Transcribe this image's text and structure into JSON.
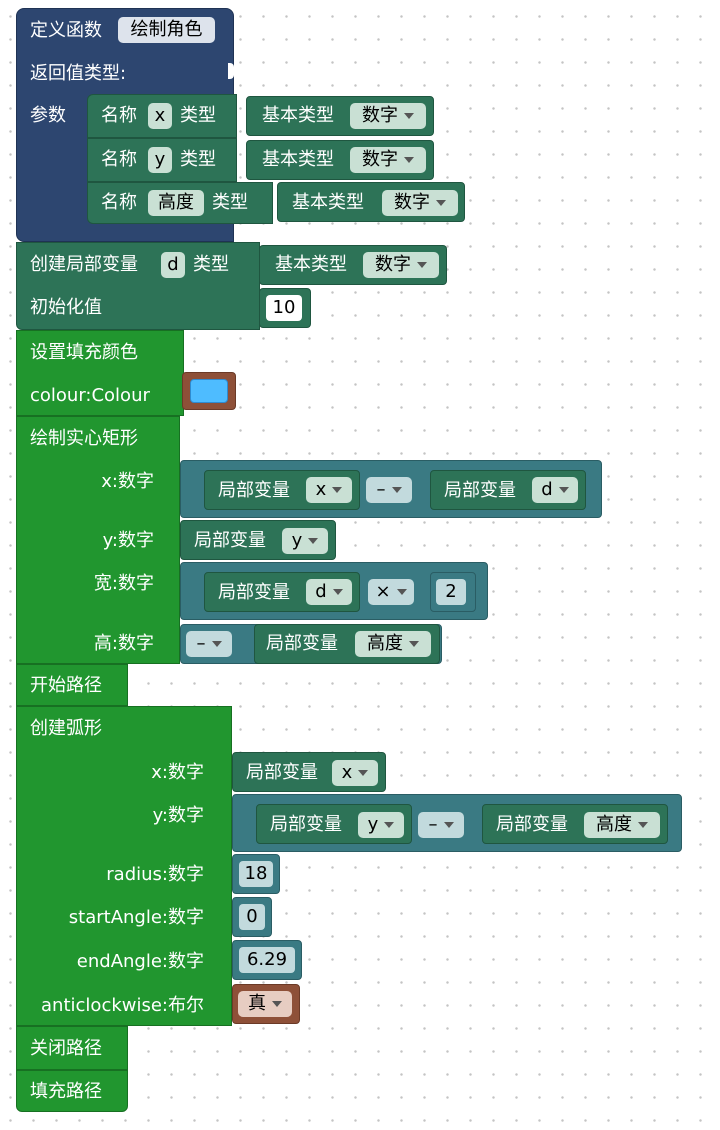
{
  "func": {
    "define_label": "定义函数",
    "name_value": "绘制角色",
    "return_type_label": "返回值类型:",
    "params_label": "参数",
    "params": [
      {
        "name_label": "名称",
        "name_value": "x",
        "type_label": "类型",
        "basic_type_label": "基本类型",
        "type_value": "数字"
      },
      {
        "name_label": "名称",
        "name_value": "y",
        "type_label": "类型",
        "basic_type_label": "基本类型",
        "type_value": "数字"
      },
      {
        "name_label": "名称",
        "name_value": "高度",
        "type_label": "类型",
        "basic_type_label": "基本类型",
        "type_value": "数字"
      }
    ]
  },
  "local_var": {
    "label": "创建局部变量",
    "name_value": "d",
    "type_label": "类型",
    "basic_type_label": "基本类型",
    "type_value": "数字",
    "init_label": "初始化值",
    "init_value": "10"
  },
  "fill_color": {
    "label": "设置填充颜色",
    "colour_label": "colour:Colour",
    "colour_value": "#4ebcff"
  },
  "fill_rect": {
    "label": "绘制实心矩形",
    "x_label": "x:数字",
    "x_left_label": "局部变量",
    "x_left_value": "x",
    "x_op": "–",
    "x_right_label": "局部变量",
    "x_right_value": "d",
    "y_label": "y:数字",
    "y_var_label": "局部变量",
    "y_var_value": "y",
    "w_label": "宽:数字",
    "w_var_label": "局部变量",
    "w_var_value": "d",
    "w_op": "×",
    "w_num": "2",
    "h_label": "高:数字",
    "h_op": "–",
    "h_var_label": "局部变量",
    "h_var_value": "高度"
  },
  "begin_path": {
    "label": "开始路径"
  },
  "arc": {
    "label": "创建弧形",
    "x_label": "x:数字",
    "x_var_label": "局部变量",
    "x_var_value": "x",
    "y_label": "y:数字",
    "y_left_label": "局部变量",
    "y_left_value": "y",
    "y_op": "–",
    "y_right_label": "局部变量",
    "y_right_value": "高度",
    "radius_label": "radius:数字",
    "radius_value": "18",
    "start_label": "startAngle:数字",
    "start_value": "0",
    "end_label": "endAngle:数字",
    "end_value": "6.29",
    "anticlockwise_label": "anticlockwise:布尔",
    "anticlockwise_value": "真"
  },
  "close_path": {
    "label": "关闭路径"
  },
  "fill_path": {
    "label": "填充路径"
  },
  "icons": {
    "dropdown": "chevron-down-icon"
  }
}
